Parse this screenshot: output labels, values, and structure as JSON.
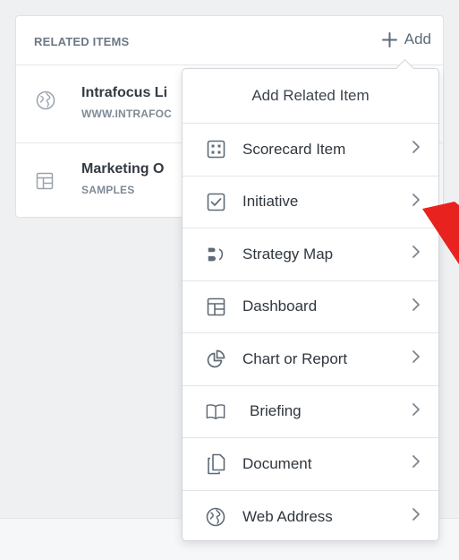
{
  "panel": {
    "title": "RELATED ITEMS",
    "add_label": "Add",
    "items": [
      {
        "name": "Intrafocus Li",
        "sub": "WWW.INTRAFOC",
        "icon": "globe-icon"
      },
      {
        "name": "Marketing O",
        "sub": "SAMPLES",
        "icon": "dashboard-icon"
      }
    ]
  },
  "dropdown": {
    "title": "Add Related Item",
    "items": [
      {
        "label": "Scorecard Item",
        "icon": "scorecard-icon"
      },
      {
        "label": "Initiative",
        "icon": "checkbox-icon"
      },
      {
        "label": "Strategy Map",
        "icon": "strategy-map-icon"
      },
      {
        "label": "Dashboard",
        "icon": "dashboard-icon"
      },
      {
        "label": "Chart or Report",
        "icon": "pie-chart-icon"
      },
      {
        "label": "Briefing",
        "icon": "book-icon"
      },
      {
        "label": "Document",
        "icon": "document-icon"
      },
      {
        "label": "Web Address",
        "icon": "globe-icon"
      }
    ]
  },
  "colors": {
    "annotation_arrow": "#e8231f",
    "icon": "#5f6b77"
  }
}
